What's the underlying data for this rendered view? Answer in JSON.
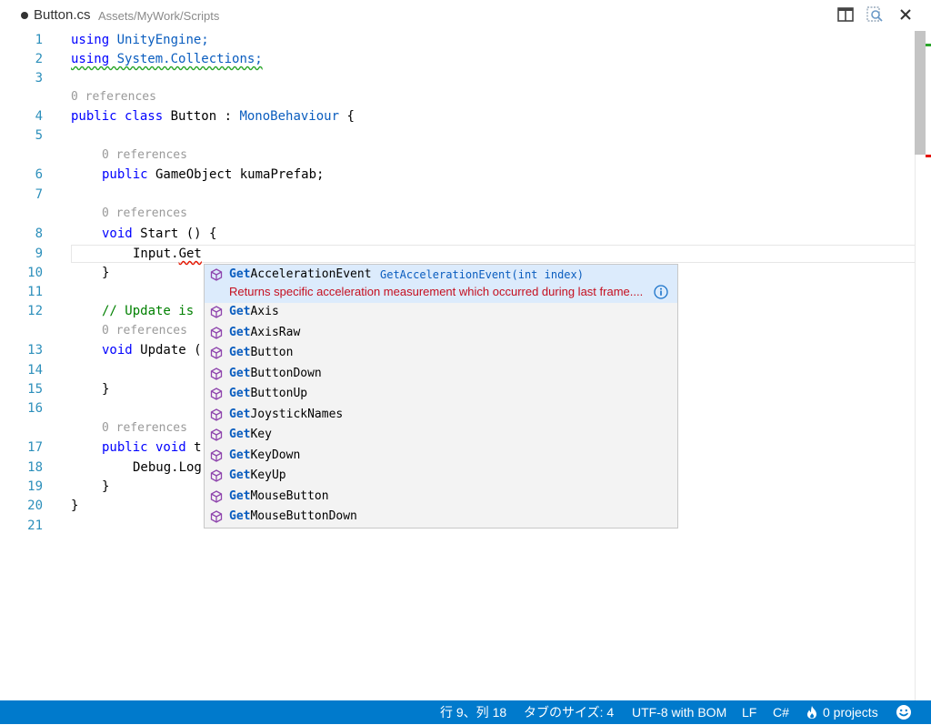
{
  "title_bar": {
    "file_name": "Button.cs",
    "file_path": "Assets/MyWork/Scripts",
    "icons": [
      "split-editor-icon",
      "open-preview-icon",
      "close-icon"
    ]
  },
  "editor": {
    "line_numbers": [
      "1",
      "2",
      "3",
      "4",
      "5",
      "6",
      "7",
      "8",
      "9",
      "10",
      "11",
      "12",
      "13",
      "14",
      "15",
      "16",
      "17",
      "18",
      "19",
      "20",
      "21"
    ],
    "lens_text": "0 references",
    "code": {
      "l1_kw": "using",
      "l1_rest": " UnityEngine;",
      "l2_kw": "using",
      "l2_rest": " System.Collections;",
      "l4_kw": "public class",
      "l4_name": " Button : ",
      "l4_base": "MonoBehaviour",
      "l4_end": " {",
      "l6_kw": "public",
      "l6_rest": " GameObject kumaPrefab;",
      "l8_kw": "void",
      "l8_rest": " Start () {",
      "l9_prefix": "Input.",
      "l9_typed": "Get",
      "l10": "}",
      "l12_comment": "// Update is",
      "l13_kw": "void",
      "l13_rest": " Update (",
      "l15": "}",
      "l17_kw": "public void",
      "l17_rest": " t",
      "l18": "Debug.Log",
      "l19": "}",
      "l20": "}"
    }
  },
  "suggest": {
    "match_prefix": "Get",
    "items": [
      {
        "rest": "AccelerationEvent",
        "icon": "method-cube-icon"
      },
      {
        "rest": "Axis",
        "icon": "method-cube-icon"
      },
      {
        "rest": "AxisRaw",
        "icon": "method-cube-icon"
      },
      {
        "rest": "Button",
        "icon": "method-cube-icon"
      },
      {
        "rest": "ButtonDown",
        "icon": "method-cube-icon"
      },
      {
        "rest": "ButtonUp",
        "icon": "method-cube-icon"
      },
      {
        "rest": "JoystickNames",
        "icon": "method-cube-icon"
      },
      {
        "rest": "Key",
        "icon": "method-cube-icon"
      },
      {
        "rest": "KeyDown",
        "icon": "method-cube-icon"
      },
      {
        "rest": "KeyUp",
        "icon": "method-cube-icon"
      },
      {
        "rest": "MouseButton",
        "icon": "method-cube-icon"
      },
      {
        "rest": "MouseButtonDown",
        "icon": "method-cube-icon"
      }
    ],
    "selected_signature": "GetAccelerationEvent(int index)",
    "selected_doc": "Returns specific acceleration measurement which occurred during last frame....",
    "info_icon": "info-icon"
  },
  "status_bar": {
    "position": "行 9、列 18",
    "tab_size": "タブのサイズ: 4",
    "encoding": "UTF-8 with BOM",
    "eol": "LF",
    "language": "C#",
    "projects": "0 projects",
    "icons": [
      "flame-icon",
      "feedback-smiley-icon"
    ]
  },
  "colors": {
    "status_bar": "#007acc",
    "line_number": "#2c8fbb",
    "keyword": "#0000ff",
    "match_highlight": "#0a5dbf",
    "suggest_focused": "#dcebfc",
    "doc_text": "#c50f1f"
  }
}
